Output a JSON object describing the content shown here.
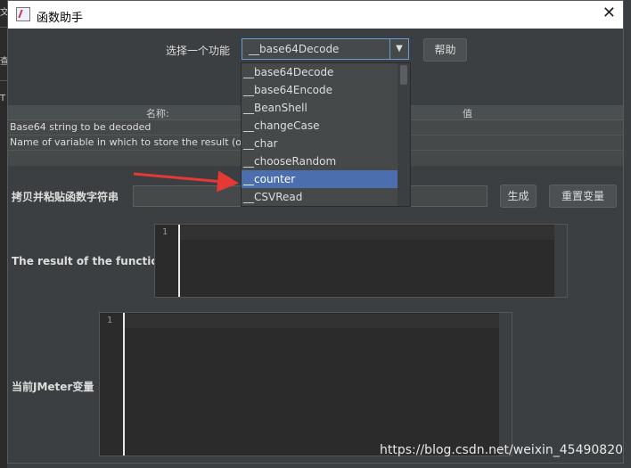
{
  "window": {
    "title": "函数助手",
    "close_label": "✕"
  },
  "function_label": "选择一个功能",
  "function_select": {
    "value": "__base64Decode",
    "arrow": "▼"
  },
  "help_button": "帮助",
  "params_table": {
    "headers": [
      "名称:",
      "值"
    ],
    "rows": [
      {
        "name": "Base64 string to be decoded",
        "value": ""
      },
      {
        "name": "Name of variable in which to store the result (op",
        "value": ""
      }
    ]
  },
  "copy_label": "拷贝并粘贴函数字符串",
  "copy_input_value": "",
  "generate_button": "生成",
  "reset_button": "重置变量",
  "result_label": "The result of the function is",
  "result_editor": {
    "line_number": "1"
  },
  "jmeter_vars_label": "当前JMeter变量",
  "jmeter_editor": {
    "line_number": "1"
  },
  "dropdown_options": [
    {
      "label": "__base64Decode",
      "selected": false
    },
    {
      "label": "__base64Encode",
      "selected": false
    },
    {
      "label": "__BeanShell",
      "selected": false
    },
    {
      "label": "__changeCase",
      "selected": false
    },
    {
      "label": "__char",
      "selected": false
    },
    {
      "label": "__chooseRandom",
      "selected": false
    },
    {
      "label": "__counter",
      "selected": true
    },
    {
      "label": "__CSVRead",
      "selected": false
    }
  ],
  "background_chars": [
    "文",
    "查",
    "T"
  ],
  "watermark": "https://blog.csdn.net/weixin_45490820",
  "colors": {
    "selection": "#4b6eaf",
    "arrow": "#e53935",
    "background": "#3c3f41"
  }
}
